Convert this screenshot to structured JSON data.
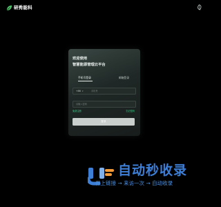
{
  "brand": {
    "name": "研秀能科",
    "icon": "leaf-logo-icon"
  },
  "top_right_icon": "leaf-icon",
  "login": {
    "greeting": "欢迎使用",
    "platform": "智慧能源管理云平台",
    "tabs": [
      {
        "label": "手机号登录",
        "active": true
      },
      {
        "label": "邮箱登录",
        "active": false
      }
    ],
    "phone_prefix": "+86",
    "phone_placeholder": "手机号",
    "code_placeholder": "请输入密码",
    "register_link": "免费注册",
    "forgot_link": "忘记密码",
    "login_button": "登录"
  },
  "watermark": {
    "title": "自动秒收录",
    "subtitle": "做上链接 → 来访一次 → 自动收录"
  },
  "colors": {
    "background": "#000000",
    "brand_green": "#4ec36a",
    "link_green": "#3ec98a",
    "watermark_blue": "#3d7fd6"
  }
}
